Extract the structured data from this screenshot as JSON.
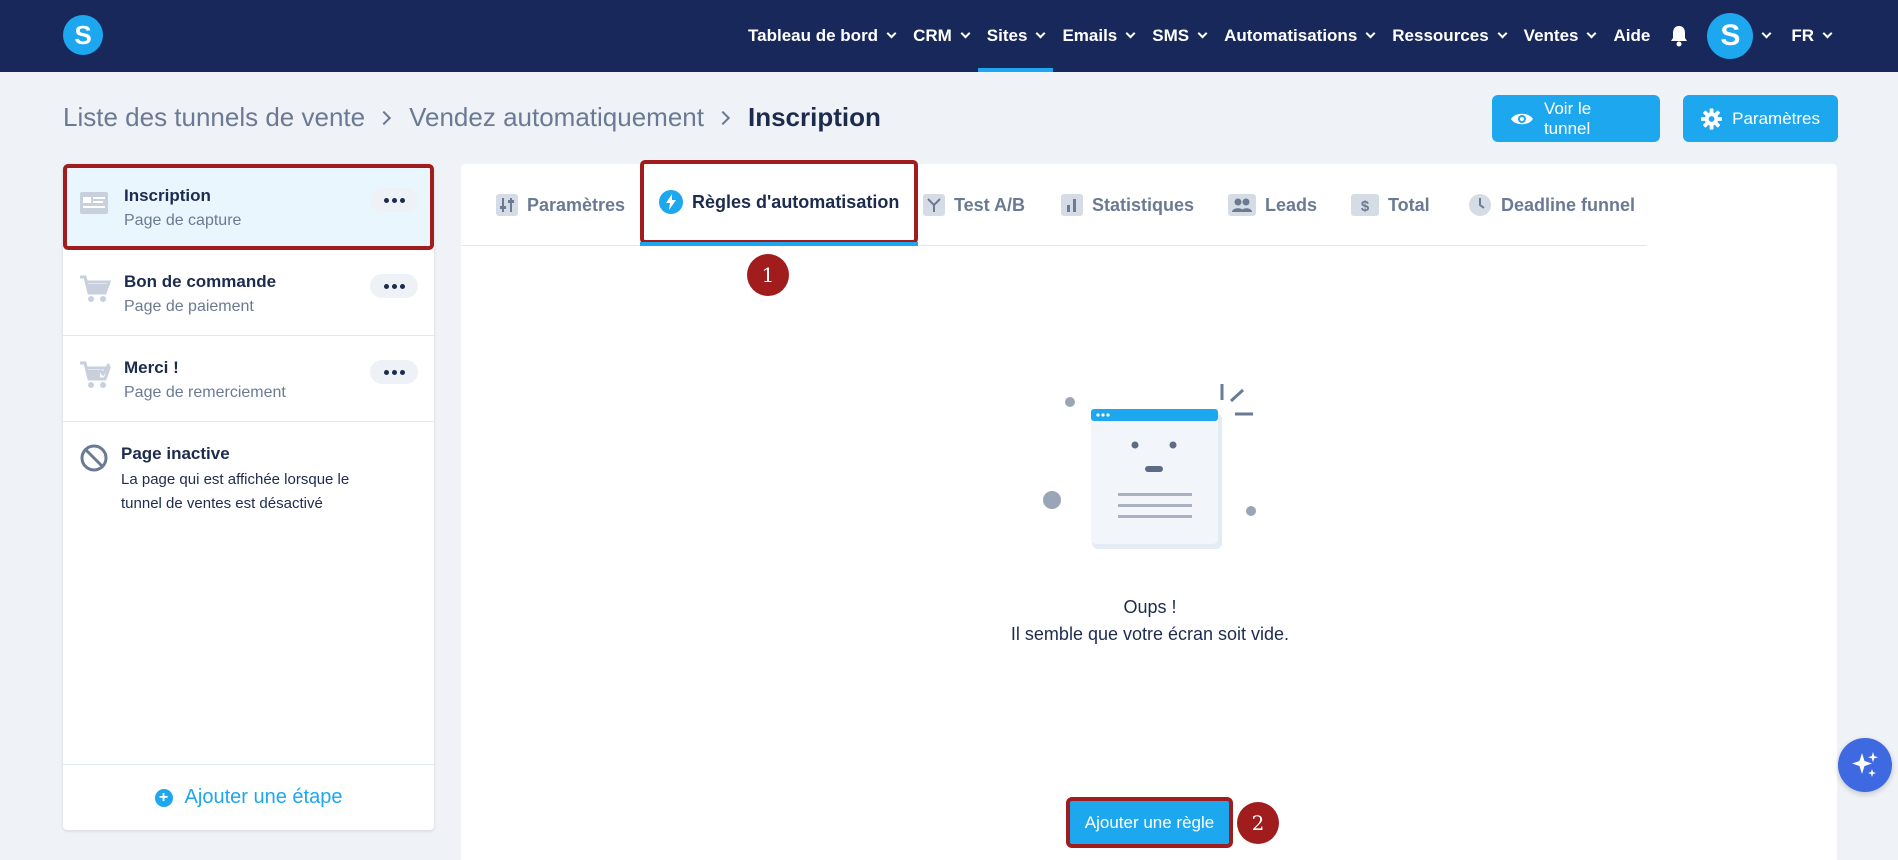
{
  "app": {
    "logo_letter": "S"
  },
  "nav": {
    "items": [
      {
        "label": "Tableau de bord",
        "has_caret": true
      },
      {
        "label": "CRM",
        "has_caret": true
      },
      {
        "label": "Sites",
        "has_caret": true,
        "active": true
      },
      {
        "label": "Emails",
        "has_caret": true
      },
      {
        "label": "SMS",
        "has_caret": true
      },
      {
        "label": "Automatisations",
        "has_caret": true
      },
      {
        "label": "Ressources",
        "has_caret": true
      },
      {
        "label": "Ventes",
        "has_caret": true
      },
      {
        "label": "Aide",
        "has_caret": false
      }
    ],
    "bell_icon": "bell-icon",
    "avatar_letter": "S",
    "language": "FR"
  },
  "breadcrumb": {
    "items": [
      "Liste des tunnels de vente",
      "Vendez automatiquement"
    ],
    "current": "Inscription"
  },
  "actions": {
    "view_label": "Voir le tunnel",
    "settings_label": "Paramètres"
  },
  "sidebar": {
    "steps": [
      {
        "title": "Inscription",
        "subtitle": "Page de capture",
        "icon": "capture-page-icon",
        "selected": true
      },
      {
        "title": "Bon de commande",
        "subtitle": "Page de paiement",
        "icon": "cart-icon"
      },
      {
        "title": "Merci !",
        "subtitle": "Page de remerciement",
        "icon": "cart-check-icon"
      }
    ],
    "inactive": {
      "title": "Page inactive",
      "description": "La page qui est affichée lorsque le tunnel de ventes est désactivé"
    },
    "add_step_label": "Ajouter une étape"
  },
  "tabs": [
    {
      "label": "Paramètres",
      "icon": "sliders-icon"
    },
    {
      "label": "Règles d'automatisation",
      "icon": "lightning-icon",
      "active": true
    },
    {
      "label": "Test A/B",
      "icon": "split-icon"
    },
    {
      "label": "Statistiques",
      "icon": "bar-chart-icon"
    },
    {
      "label": "Leads",
      "icon": "users-icon"
    },
    {
      "label": "Total",
      "icon": "dollar-icon"
    },
    {
      "label": "Deadline funnel",
      "icon": "clock-icon"
    }
  ],
  "empty_state": {
    "line1": "Oups !",
    "line2": "Il semble que votre écran soit vide."
  },
  "add_rule_label": "Ajouter une règle",
  "annotations": [
    "1",
    "2"
  ],
  "colors": {
    "navy": "#18285a",
    "accent": "#1ca7ee",
    "annotation_red": "#a11c1c",
    "background": "#eff3f8"
  }
}
